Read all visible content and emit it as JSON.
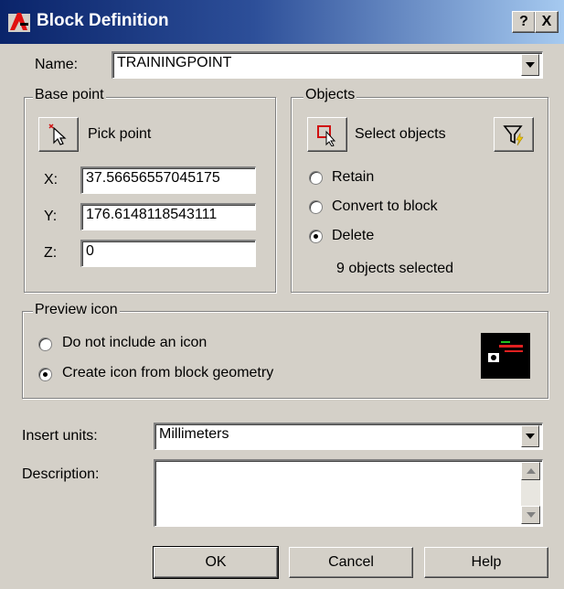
{
  "window": {
    "title": "Block Definition",
    "help_btn": "?",
    "close_btn": "X"
  },
  "name": {
    "label": "Name:",
    "value": "TRAININGPOINT"
  },
  "base_point": {
    "legend": "Base point",
    "pick_label": "Pick point",
    "x_label": "X:",
    "x_value": "37.56656557045175",
    "y_label": "Y:",
    "y_value": "176.6148118543111",
    "z_label": "Z:",
    "z_value": "0"
  },
  "objects": {
    "legend": "Objects",
    "select_label": "Select objects",
    "retain": "Retain",
    "convert": "Convert to block",
    "delete": "Delete",
    "selected_option": "Delete",
    "count": "9 objects selected"
  },
  "preview": {
    "legend": "Preview icon",
    "no_icon": "Do not include an icon",
    "from_geometry": "Create icon from block geometry",
    "selected_option": "Create icon from block geometry"
  },
  "insert_units": {
    "label": "Insert units:",
    "value": "Millimeters"
  },
  "description": {
    "label": "Description:",
    "value": ""
  },
  "buttons": {
    "ok": "OK",
    "cancel": "Cancel",
    "help": "Help"
  },
  "colors": {
    "title_start": "#0a246a",
    "title_end": "#a6caf0",
    "face": "#d4d0c8"
  }
}
